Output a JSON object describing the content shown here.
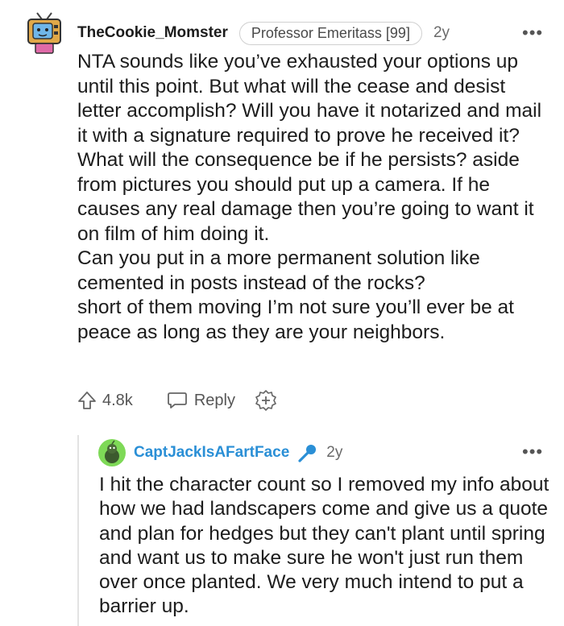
{
  "comment": {
    "username": "TheCookie_Momster",
    "flair": "Professor Emeritass [99]",
    "age": "2y",
    "more": "•••",
    "paragraphs": [
      "NTA sounds like you’ve exhausted your options up until this point. But what will the cease and desist letter accomplish? Will you have it notarized and mail it with a signature required to prove he received it? What will the consequence be if he persists? aside from pictures you should put up a camera. If he causes any real damage then you’re going to want it on film of him doing it.",
      "Can you put in a more permanent solution like cemented in posts instead of the rocks?",
      "short of them moving I’m not sure you’ll ever be at peace as long as they are your neighbors."
    ],
    "upvotes": "4.8k",
    "reply_label": "Reply",
    "avatar_icon": "tv-robot-avatar-icon"
  },
  "reply": {
    "username": "CaptJackIsAFartFace",
    "age": "2y",
    "more": "•••",
    "paragraphs": [
      "I hit the character count so I removed my info about how we had landscapers come and give us a quote and plan for hedges but they can't plant until spring and want us to make sure he won't just run them over once planted. We very much intend to put a barrier up."
    ],
    "avatar_icon": "green-snoo-avatar-icon",
    "badge_icon": "microphone-icon"
  },
  "colors": {
    "reply_username": "#2a8fd6",
    "text": "#1c1c1c",
    "muted": "#6a6a6a",
    "thread_line": "#e3e3e3"
  }
}
